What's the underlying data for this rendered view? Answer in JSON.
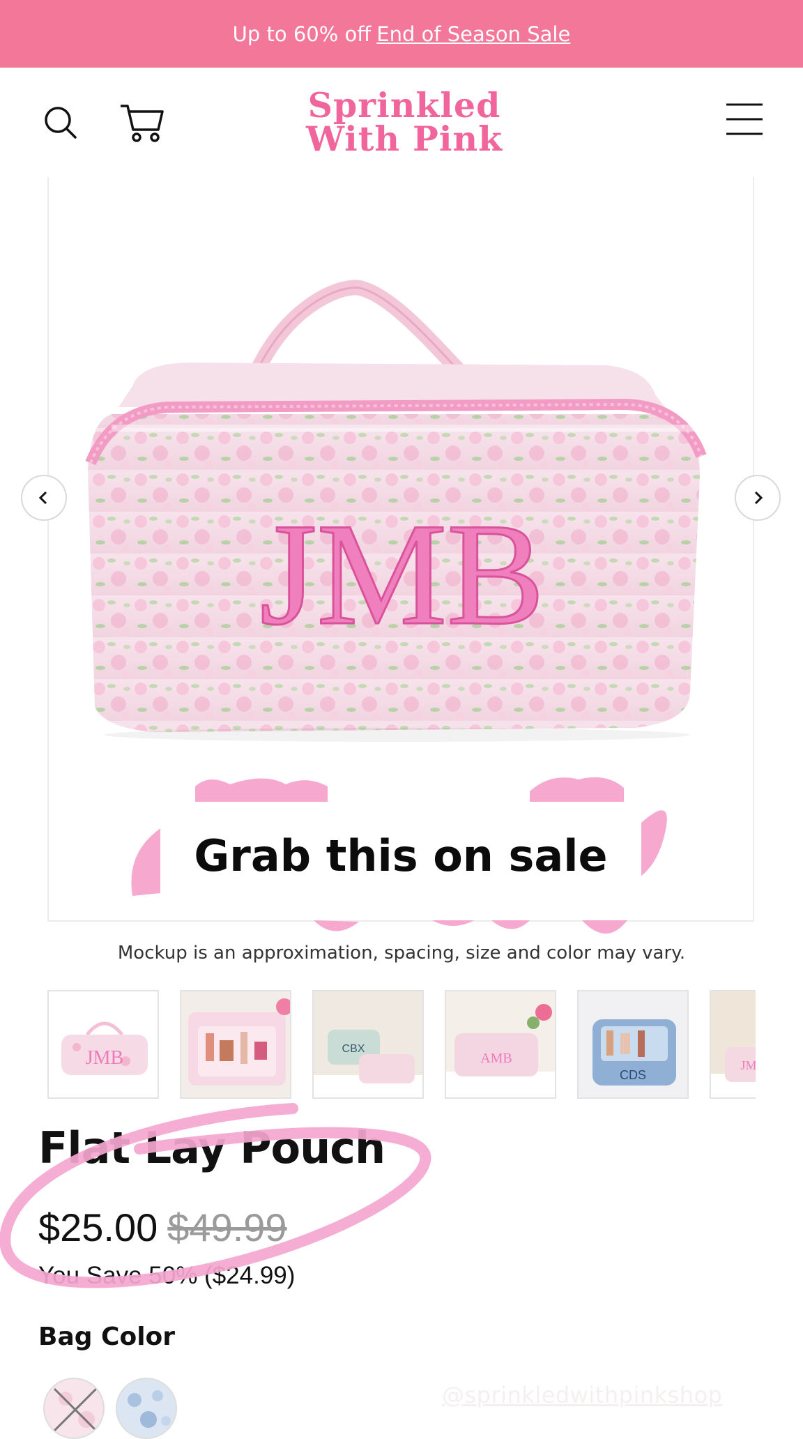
{
  "banner": {
    "text": "Up to 60% off",
    "link_text": "End of Season Sale"
  },
  "header": {
    "logo_line1": "Sprinkled",
    "logo_line2": "With Pink",
    "icons": [
      "search-icon",
      "cart-icon",
      "hamburger-menu-icon"
    ]
  },
  "product_image": {
    "monogram": "JMB",
    "overlay_text": "Grab this on sale",
    "caption": "Mockup is an approximation, spacing, size and color may vary."
  },
  "thumbnails": {
    "items": [
      {
        "label": "JMB",
        "theme": "pink floral pouch"
      },
      {
        "label": "",
        "theme": "open pouch with cosmetics"
      },
      {
        "label": "CBX",
        "theme": "pouches on vanity"
      },
      {
        "label": "AMB",
        "theme": "pouch in bathroom"
      },
      {
        "label": "CDS",
        "theme": "blue pouch with organizers"
      },
      {
        "label": "JMB",
        "theme": "pouch partial"
      }
    ]
  },
  "product": {
    "title": "Flat Lay Pouch",
    "price": "$25.00",
    "compare_price": "$49.99",
    "savings": "You Save 50% ($24.99)",
    "option_label": "Bag Color"
  },
  "watermark": "@sprinkledwithpinkshop",
  "colors": {
    "brand_pink": "#f27799",
    "logo_pink": "#f0669c",
    "annotation_pink": "#f5a6cf"
  }
}
